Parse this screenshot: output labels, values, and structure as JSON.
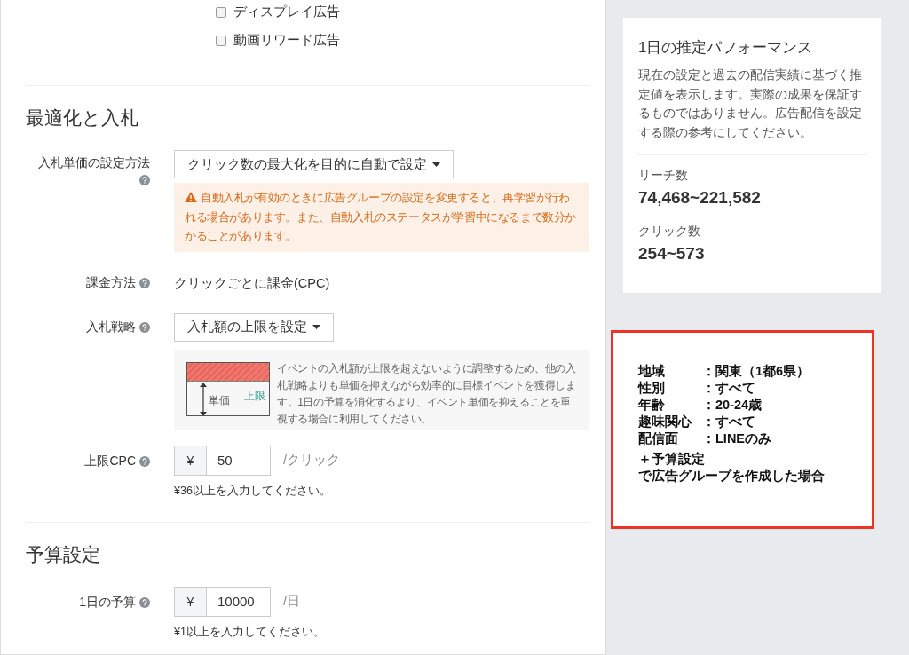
{
  "placements": [
    {
      "label": "ディスプレイ広告",
      "checked": false
    },
    {
      "label": "動画リワード広告",
      "checked": false
    }
  ],
  "bidding": {
    "heading": "最適化と入札",
    "bid_method": {
      "label": "入札単価の設定方法",
      "value": "クリック数の最大化を目的に自動で設定",
      "warning": "自動入札が有効のときに広告グループの設定を変更すると、再学習が行われる場合があります。また、自動入札のステータスが学習中になるまで数分かかることがあります。"
    },
    "billing": {
      "label": "課金方法",
      "value": "クリックごとに課金(CPC)"
    },
    "strategy": {
      "label": "入札戦略",
      "value": "入札額の上限を設定",
      "illustration_unit": "単価",
      "illustration_cap": "上限",
      "description": "イベントの入札額が上限を超えないように調整するため、他の入札戦略よりも単価を抑えながら効率的に目標イベントを獲得します。1日の予算を消化するより、イベント単価を抑えることを重視する場合に利用してください。"
    },
    "max_cpc": {
      "label": "上限CPC",
      "currency": "¥",
      "value": "50",
      "unit": "/クリック",
      "hint": "¥36以上を入力してください。"
    }
  },
  "budget": {
    "heading": "予算設定",
    "daily": {
      "label": "1日の予算",
      "currency": "¥",
      "value": "10000",
      "unit": "/日",
      "hint": "¥1以上を入力してください。"
    }
  },
  "estimate": {
    "title": "1日の推定パフォーマンス",
    "description": "現在の設定と過去の配信実績に基づく推定値を表示します。実際の成果を保証するものではありません。広告配信を設定する際の参考にしてください。",
    "metrics": [
      {
        "label": "リーチ数",
        "value": "74,468~221,582"
      },
      {
        "label": "クリック数",
        "value": "254~573"
      }
    ]
  },
  "annotation": {
    "rows": [
      {
        "label": "地域",
        "value": "：関東（1都6県）"
      },
      {
        "label": "性別",
        "value": "：すべて"
      },
      {
        "label": "年齢",
        "value": "：20-24歳"
      },
      {
        "label": "趣味関心",
        "value": "：すべて"
      },
      {
        "label": "配信面",
        "value": "：LINEのみ"
      }
    ],
    "notes": [
      "＋予算設定",
      "で広告グループを作成した場合"
    ]
  }
}
